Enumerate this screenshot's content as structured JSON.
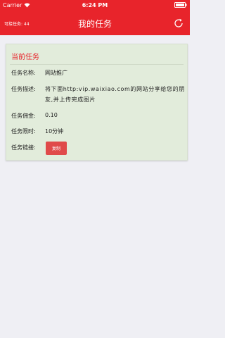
{
  "status_bar": {
    "carrier": "Carrier",
    "time": "6:24 PM",
    "wifi_icon": "wifi-icon",
    "battery_icon": "battery-icon"
  },
  "nav": {
    "left_label": "可接任务: 44",
    "title": "我的任务",
    "refresh_icon": "refresh-icon",
    "accent_color": "#e8242b"
  },
  "task_card": {
    "title": "当前任务",
    "name_label": "任务名称:",
    "name_value": "网站推广",
    "desc_label": "任务描述:",
    "desc_value": "将下面http:vip.waixiao.com的网站分享给您的朋友,并上传完成图片",
    "reward_label": "任务佣金:",
    "reward_value": "0.10",
    "time_label": "任务限时:",
    "time_value": "10分钟",
    "link_label": "任务链接:",
    "copy_button": "复制",
    "background_color": "#e2ecdb"
  }
}
